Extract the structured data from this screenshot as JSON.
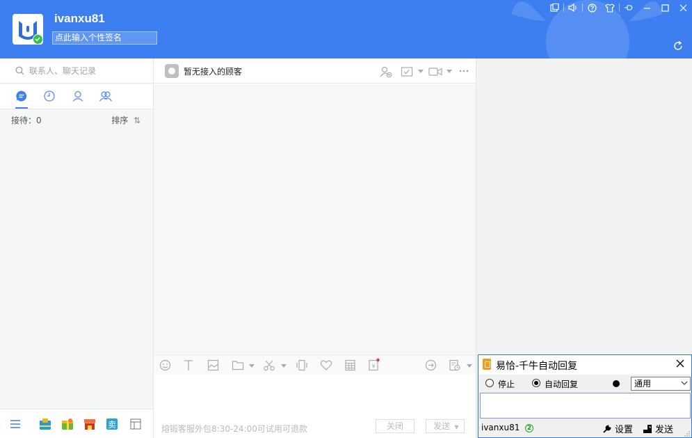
{
  "header": {
    "username": "ivanxu81",
    "signature_placeholder": "点此输入个性签名",
    "brand_color": "#3d7ff0"
  },
  "window_controls": [
    "feedback-icon",
    "volume-icon",
    "help-icon",
    "skin-icon",
    "pin-icon",
    "minimize-icon",
    "maximize-icon",
    "close-icon"
  ],
  "left_panel": {
    "search_placeholder": "联系人、聊天记录",
    "tabs": [
      "chat-icon",
      "recent-icon",
      "contact-icon",
      "group-icon"
    ],
    "reception": "接待：0",
    "sort": "排序"
  },
  "chat_panel": {
    "no_customer": "暂无接入的顾客",
    "promo": "熔锻客服外包8:30-24:00可试用可退款",
    "close_label": "关闭",
    "send_label": "发送"
  },
  "dialog": {
    "title": "易恰-千牛自动回复",
    "options": [
      {
        "label": "停止",
        "checked": false
      },
      {
        "label": "自动回复",
        "checked": true
      }
    ],
    "select_value": "通用",
    "user": "ivanxu81",
    "help_badge": "2",
    "settings_label": "设置",
    "send_label": "发送"
  }
}
